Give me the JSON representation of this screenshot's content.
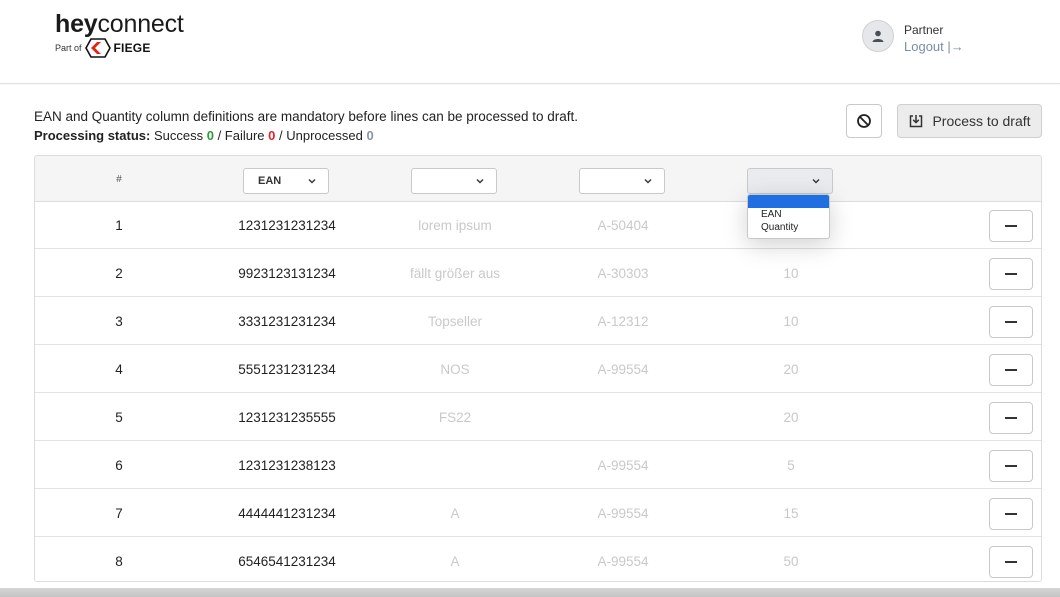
{
  "header": {
    "brand_bold": "hey",
    "brand_light": "connect",
    "part_of": "Part of",
    "fiege": "FIEGE",
    "user_role": "Partner",
    "logout": "Logout |→"
  },
  "info": {
    "message": "EAN and Quantity column definitions are mandatory before lines can be processed to draft.",
    "status_label": "Processing status:",
    "success_label": "Success",
    "success_count": "0",
    "failure_label": "/ Failure",
    "failure_count": "0",
    "unprocessed_label": "/ Unprocessed",
    "unprocessed_count": "0"
  },
  "toolbar": {
    "process_label": "Process to draft"
  },
  "table": {
    "hash_header": "#",
    "col_selects": [
      "EAN",
      "",
      "",
      ""
    ],
    "dropdown_options": [
      "EAN",
      "Quantity"
    ],
    "rows": [
      {
        "num": "1",
        "ean": "1231231231234",
        "c3": "lorem ipsum",
        "c4": "A-50404",
        "c5": ""
      },
      {
        "num": "2",
        "ean": "9923123131234",
        "c3": "fällt größer aus",
        "c4": "A-30303",
        "c5": "10"
      },
      {
        "num": "3",
        "ean": "3331231231234",
        "c3": "Topseller",
        "c4": "A-12312",
        "c5": "10"
      },
      {
        "num": "4",
        "ean": "5551231231234",
        "c3": "NOS",
        "c4": "A-99554",
        "c5": "20"
      },
      {
        "num": "5",
        "ean": "1231231235555",
        "c3": "FS22",
        "c4": "",
        "c5": "20"
      },
      {
        "num": "6",
        "ean": "1231231238123",
        "c3": "",
        "c4": "A-99554",
        "c5": "5"
      },
      {
        "num": "7",
        "ean": "4444441231234",
        "c3": "A",
        "c4": "A-99554",
        "c5": "15"
      },
      {
        "num": "8",
        "ean": "6546541231234",
        "c3": "A",
        "c4": "A-99554",
        "c5": "50"
      }
    ]
  },
  "colors": {
    "success": "#2e9a3c",
    "failure": "#e0242b",
    "unprocessed": "#8b95a3",
    "dropdown_highlight": "#1f6fe3",
    "fiege_red": "#e2231a"
  },
  "icons": {
    "cancel": "ban-icon",
    "process": "download-tray-icon",
    "remove": "minus-icon",
    "avatar": "user-icon"
  }
}
